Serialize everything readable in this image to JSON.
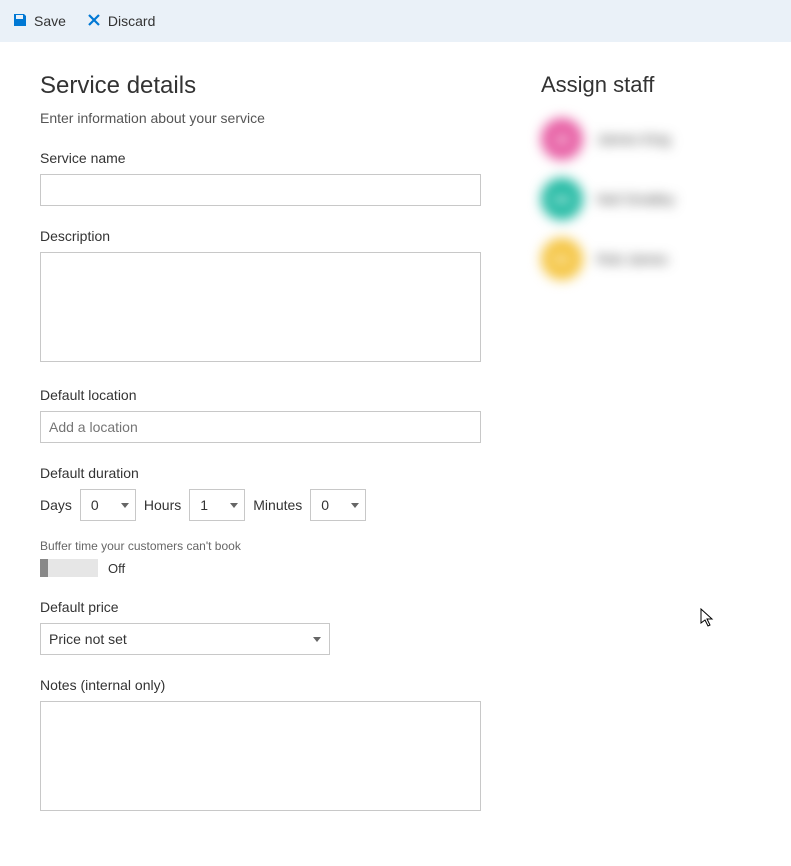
{
  "toolbar": {
    "save_label": "Save",
    "discard_label": "Discard"
  },
  "details": {
    "heading": "Service details",
    "subtitle": "Enter information about your service",
    "service_name_label": "Service name",
    "service_name_value": "",
    "description_label": "Description",
    "description_value": "",
    "location_label": "Default location",
    "location_placeholder": "Add a location",
    "location_value": "",
    "duration_label": "Default duration",
    "days_label": "Days",
    "days_value": "0",
    "hours_label": "Hours",
    "hours_value": "1",
    "minutes_label": "Minutes",
    "minutes_value": "0",
    "buffer_hint": "Buffer time your customers can't book",
    "buffer_toggle_label": "Off",
    "price_label": "Default price",
    "price_value": "Price not set",
    "notes_label": "Notes (internal only)",
    "notes_value": ""
  },
  "assign": {
    "heading": "Assign staff",
    "staff": [
      {
        "initials": "JK",
        "name": "James King",
        "color": "#e75da3"
      },
      {
        "initials": "NS",
        "name": "Neil Smalley",
        "color": "#1fb9a2"
      },
      {
        "initials": "RJ",
        "name": "Rob James",
        "color": "#f5c542"
      }
    ]
  }
}
